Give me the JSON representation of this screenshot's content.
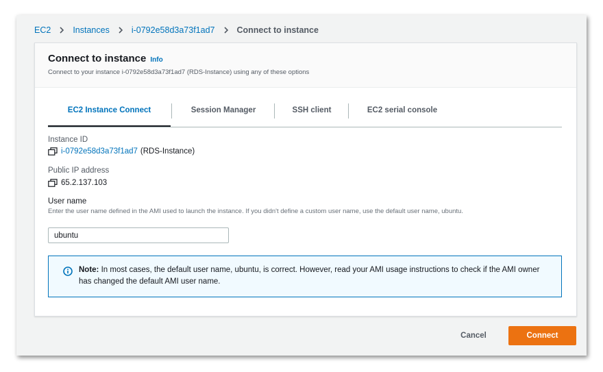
{
  "breadcrumb": {
    "items": [
      "EC2",
      "Instances",
      "i-0792e58d3a73f1ad7"
    ],
    "current": "Connect to instance"
  },
  "header": {
    "title": "Connect to instance",
    "info": "Info",
    "subtitle": "Connect to your instance i-0792e58d3a73f1ad7 (RDS-Instance) using any of these options"
  },
  "tabs": [
    {
      "label": "EC2 Instance Connect",
      "active": true
    },
    {
      "label": "Session Manager",
      "active": false
    },
    {
      "label": "SSH client",
      "active": false
    },
    {
      "label": "EC2 serial console",
      "active": false
    }
  ],
  "instance": {
    "id_label": "Instance ID",
    "id_value": "i-0792e58d3a73f1ad7",
    "id_name": "(RDS-Instance)",
    "ip_label": "Public IP address",
    "ip_value": "65.2.137.103"
  },
  "username": {
    "label": "User name",
    "help": "Enter the user name defined in the AMI used to launch the instance. If you didn't define a custom user name, use the default user name, ubuntu.",
    "value": "ubuntu"
  },
  "note": {
    "prefix": "Note:",
    "text": "In most cases, the default user name, ubuntu, is correct. However, read your AMI usage instructions to check if the AMI owner has changed the default AMI user name."
  },
  "footer": {
    "cancel": "Cancel",
    "connect": "Connect"
  },
  "colors": {
    "link": "#0073bb",
    "primary": "#ec7211",
    "note_bg": "#f1faff"
  },
  "icons": [
    "chevron-right-icon",
    "copy-icon",
    "info-circle-icon"
  ]
}
